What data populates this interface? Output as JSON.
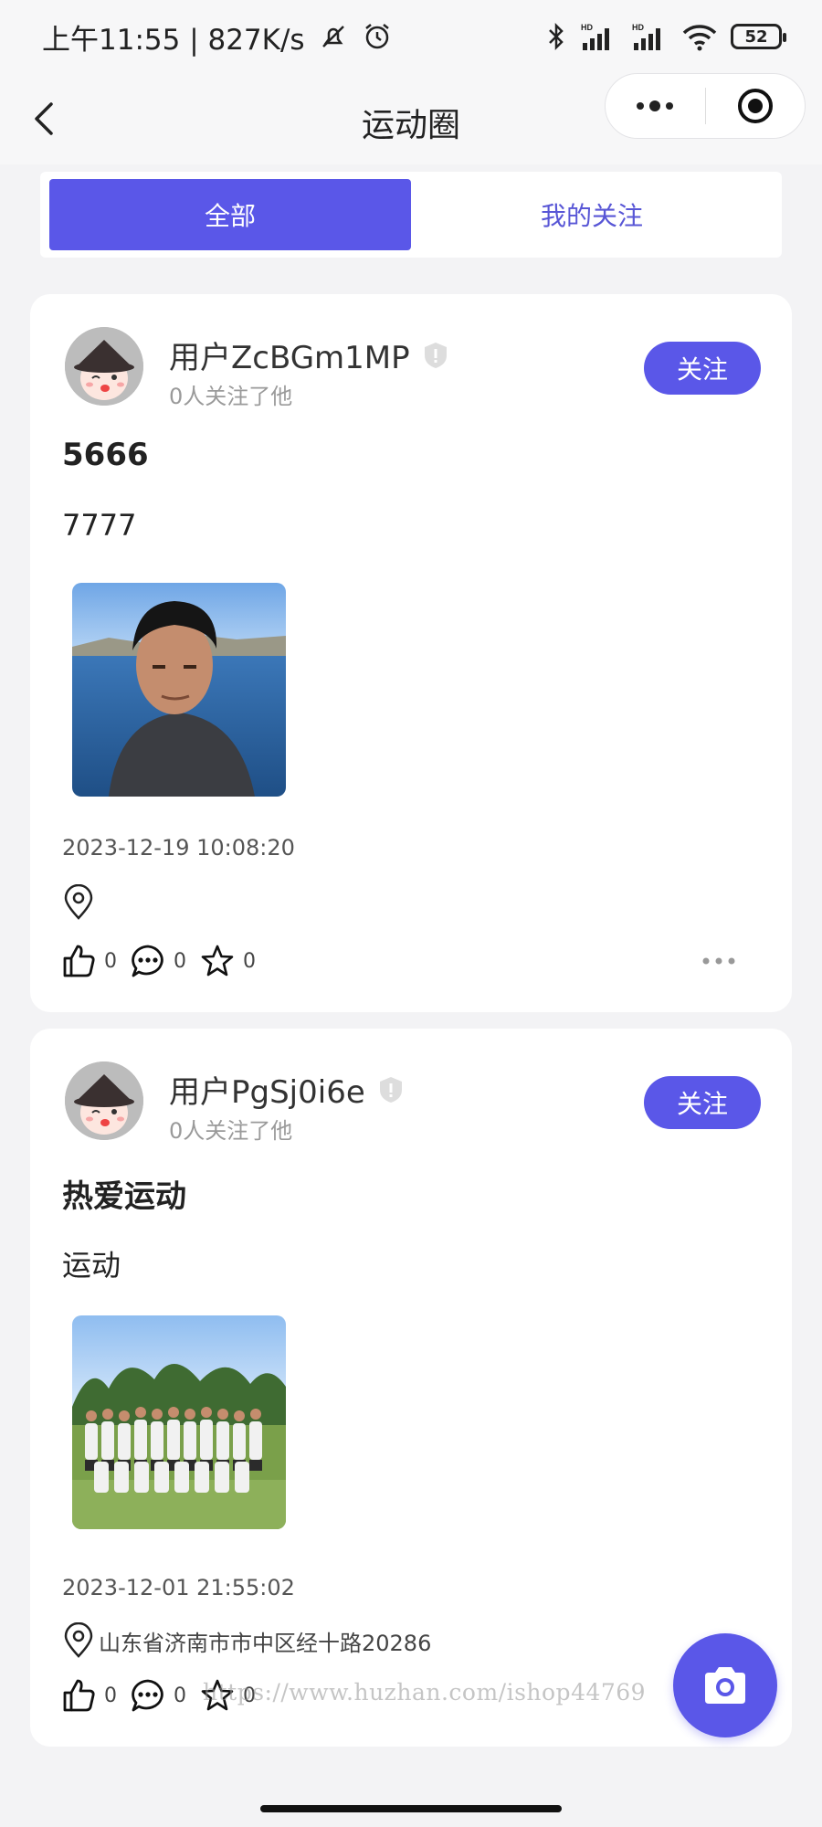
{
  "status_bar": {
    "time_speed": "上午11:55 | 827K/s",
    "battery": "52"
  },
  "nav": {
    "title": "运动圈"
  },
  "tabs": [
    {
      "label": "全部",
      "active": true
    },
    {
      "label": "我的关注",
      "active": false
    }
  ],
  "posts": [
    {
      "username": "用户ZcBGm1MP",
      "followers": "0人关注了他",
      "follow_label": "关注",
      "title": "5666",
      "body": "7777",
      "time": "2023-12-19 10:08:20",
      "location": "",
      "likes": "0",
      "comments": "0",
      "stars": "0"
    },
    {
      "username": "用户PgSj0i6e",
      "followers": "0人关注了他",
      "follow_label": "关注",
      "title": "热爱运动",
      "body": "运动",
      "time": "2023-12-01 21:55:02",
      "location": "山东省济南市市中区经十路20286",
      "likes": "0",
      "comments": "0",
      "stars": "0"
    }
  ],
  "watermark": "https://www.huzhan.com/ishop44769",
  "colors": {
    "accent": "#5a57e8",
    "background": "#f3f3f5"
  }
}
